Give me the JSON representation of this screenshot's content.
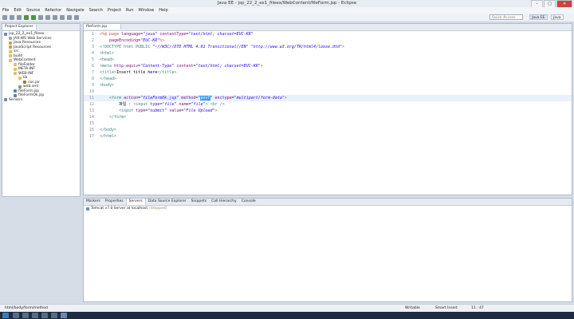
{
  "window": {
    "title": "Java EE - jsp_22_2_ex1_fileex/WebContent/fileForm.jsp - Eclipse"
  },
  "menu": [
    "File",
    "Edit",
    "Source",
    "Refactor",
    "Navigate",
    "Search",
    "Project",
    "Run",
    "Window",
    "Help"
  ],
  "toolbar": {
    "quick_access": "Quick Access",
    "perspective_javaee": "Java EE",
    "perspective_java": "Java"
  },
  "explorer": {
    "tab": "Project Explorer",
    "tree": [
      "jsp_22_2_ex1_fileex",
      "JAX-WS Web Services",
      "Java Resources",
      "JavaScript Resources",
      "src",
      "build",
      "WebContent",
      "fileFolder",
      "META-INF",
      "WEB-INF",
      "lib",
      "cos.jar",
      "web.xml",
      "fileForm.jsp",
      "fileFormOk.jsp",
      "Servers"
    ]
  },
  "editor": {
    "tab": "fileForm.jsp",
    "lines": [
      {
        "n": "1",
        "t": "<%@ page language=\"java\" contentType=\"text/html; charset=EUC-KR\""
      },
      {
        "n": "2",
        "t": "    pageEncoding=\"EUC-KR\"%>"
      },
      {
        "n": "3",
        "t": "<!DOCTYPE html PUBLIC \"-//W3C//DTD HTML 4.01 Transitional//EN\" \"http://www.w3.org/TR/html4/loose.dtd\">"
      },
      {
        "n": "4",
        "t": "<html>"
      },
      {
        "n": "5",
        "t": "<head>"
      },
      {
        "n": "6",
        "t": "<meta http-equiv=\"Content-Type\" content=\"text/html; charset=EUC-KR\">"
      },
      {
        "n": "7",
        "t": "<title>Insert title here</title>"
      },
      {
        "n": "8",
        "t": "</head>"
      },
      {
        "n": "9",
        "t": "<body>"
      },
      {
        "n": "10",
        "t": ""
      },
      {
        "n": "11",
        "t": "    <form action=\"fileFormOk.jsp\" method=\"post\" enctype=\"multipart/form-data\">"
      },
      {
        "n": "12",
        "t": "        파일 : <input type=\"file\" name=\"file\"> <br />"
      },
      {
        "n": "13",
        "t": "        <input type=\"submit\" value=\"File Upload\">"
      },
      {
        "n": "14",
        "t": "    </form>"
      },
      {
        "n": "15",
        "t": ""
      },
      {
        "n": "16",
        "t": "</body>"
      },
      {
        "n": "17",
        "t": "</html>"
      }
    ],
    "selected_word": "post"
  },
  "bottom": {
    "tabs": [
      "Markers",
      "Properties",
      "Servers",
      "Data Source Explorer",
      "Snippets",
      "Call Hierarchy",
      "Console"
    ],
    "server_row": "Tomcat v7.0 Server at localhost",
    "server_state": "[Stopped]"
  },
  "status": {
    "path": "html/body/form/method",
    "writable": "Writable",
    "insert": "Smart Insert",
    "position": "11 : 47"
  },
  "colors": {
    "accent": "#3399ff",
    "tag": "#3f7f7f",
    "attr": "#7f007f",
    "string": "#2a00ff"
  }
}
